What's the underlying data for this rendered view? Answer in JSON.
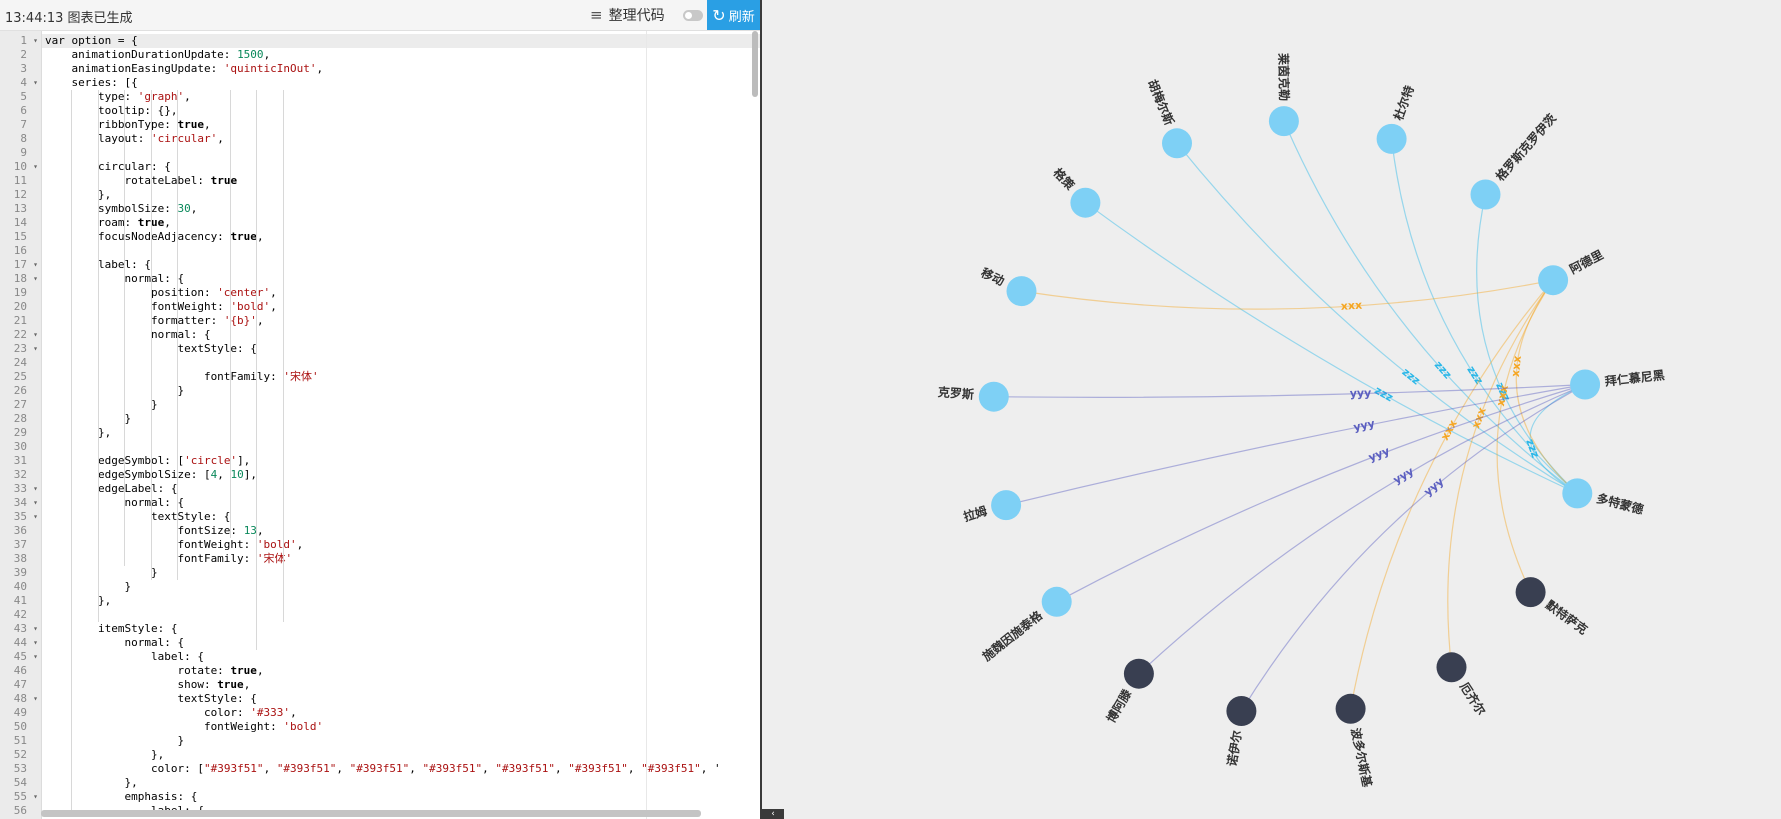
{
  "toolbar": {
    "status": "13:44:13  图表已生成",
    "format_icon": "format-lines-icon",
    "format_label": "整理代码",
    "refresh_icon": "refresh-icon",
    "refresh_label": "刷新",
    "accent_color": "#2a9fe4"
  },
  "editor": {
    "lines": [
      "var option = {",
      "    animationDurationUpdate: 1500,",
      "    animationEasingUpdate: 'quinticInOut',",
      "    series: [{",
      "        type: 'graph',",
      "        tooltip: {},",
      "        ribbonType: true,",
      "        layout: 'circular',",
      "",
      "        circular: {",
      "            rotateLabel: true",
      "        },",
      "        symbolSize: 30,",
      "        roam: true,",
      "        focusNodeAdjacency: true,",
      "",
      "        label: {",
      "            normal: {",
      "                position: 'center',",
      "                fontWeight: 'bold',",
      "                formatter: '{b}',",
      "                normal: {",
      "                    textStyle: {",
      "",
      "                        fontFamily: '宋体'",
      "                    }",
      "                }",
      "            }",
      "        },",
      "",
      "        edgeSymbol: ['circle'],",
      "        edgeSymbolSize: [4, 10],",
      "        edgeLabel: {",
      "            normal: {",
      "                textStyle: {",
      "                    fontSize: 13,",
      "                    fontWeight: 'bold',",
      "                    fontFamily: '宋体'",
      "                }",
      "            }",
      "        },",
      "",
      "        itemStyle: {",
      "            normal: {",
      "                label: {",
      "                    rotate: true,",
      "                    show: true,",
      "                    textStyle: {",
      "                        color: '#333',",
      "                        fontWeight: 'bold'",
      "                    }",
      "                },",
      "                color: [\"#393f51\", \"#393f51\", \"#393f51\", \"#393f51\", \"#393f51\", \"#393f51\", \"#393f51\", '",
      "            },",
      "            emphasis: {",
      "                label: {"
    ],
    "fold_lines": [
      1,
      4,
      10,
      17,
      18,
      22,
      23,
      33,
      34,
      35,
      43,
      44,
      45,
      48,
      55
    ]
  },
  "graph": {
    "node_blue": "#7ed0f5",
    "node_dark": "#393f51",
    "edge_colors": {
      "zzz": "#2bb7e8",
      "xxx": "#f5a623",
      "yyy": "#5b5fc0"
    },
    "nodes": [
      {
        "name": "杜尔特",
        "dark": false
      },
      {
        "name": "格罗斯克罗伊茨",
        "dark": false
      },
      {
        "name": "阿德里",
        "dark": false
      },
      {
        "name": "拜仁慕尼黑",
        "dark": false
      },
      {
        "name": "多特蒙德",
        "dark": false
      },
      {
        "name": "默特萨克",
        "dark": true
      },
      {
        "name": "厄齐尔",
        "dark": true
      },
      {
        "name": "波多尔斯基",
        "dark": true
      },
      {
        "name": "诺伊尔",
        "dark": true
      },
      {
        "name": "博阿滕",
        "dark": true
      },
      {
        "name": "施魏因施泰格",
        "dark": false
      },
      {
        "name": "拉姆",
        "dark": false
      },
      {
        "name": "克罗斯",
        "dark": false
      },
      {
        "name": "移动",
        "dark": false
      },
      {
        "name": "格策",
        "dark": false
      },
      {
        "name": "胡梅尔斯",
        "dark": false
      },
      {
        "name": "莱茵克勒",
        "dark": false
      }
    ],
    "edges": [
      {
        "source": 4,
        "target": 14,
        "label": "zzz",
        "type": "zzz"
      },
      {
        "source": 4,
        "target": 15,
        "label": "zzz",
        "type": "zzz"
      },
      {
        "source": 4,
        "target": 16,
        "label": "zzz",
        "type": "zzz"
      },
      {
        "source": 4,
        "target": 0,
        "label": "zzz",
        "type": "zzz"
      },
      {
        "source": 4,
        "target": 1,
        "label": "zzz",
        "type": "zzz"
      },
      {
        "source": 4,
        "target": 3,
        "label": "zzz",
        "type": "zzz"
      },
      {
        "source": 2,
        "target": 13,
        "label": "xxx",
        "type": "xxx"
      },
      {
        "source": 2,
        "target": 5,
        "label": "xxx",
        "type": "xxx"
      },
      {
        "source": 2,
        "target": 6,
        "label": "xxx",
        "type": "xxx"
      },
      {
        "source": 2,
        "target": 7,
        "label": "xxx",
        "type": "xxx"
      },
      {
        "source": 2,
        "target": 4,
        "label": "xxx",
        "type": "xxx"
      },
      {
        "source": 3,
        "target": 12,
        "label": "yyy",
        "type": "yyy"
      },
      {
        "source": 3,
        "target": 11,
        "label": "yyy",
        "type": "yyy"
      },
      {
        "source": 3,
        "target": 10,
        "label": "yyy",
        "type": "yyy"
      },
      {
        "source": 3,
        "target": 9,
        "label": "yyy",
        "type": "yyy"
      },
      {
        "source": 3,
        "target": 8,
        "label": "yyy",
        "type": "yyy"
      }
    ]
  }
}
